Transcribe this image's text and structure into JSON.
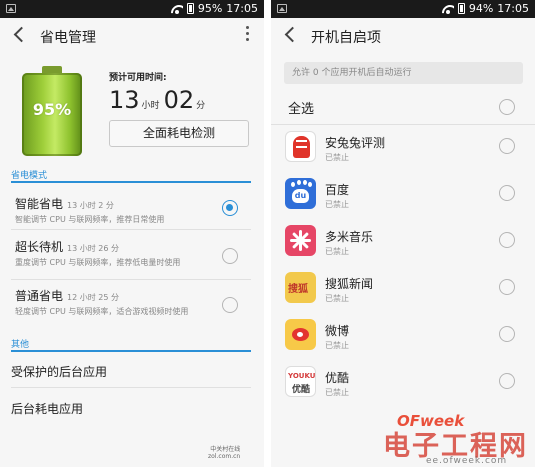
{
  "left": {
    "status": {
      "battery_pct": "95%",
      "time": "17:05"
    },
    "appbar": {
      "title": "省电管理"
    },
    "battery": {
      "percent_label": "95%",
      "level": 0.95
    },
    "estimate": {
      "label": "预计可用时间:",
      "hours": "13",
      "hours_unit": "小时",
      "minutes": "02",
      "minutes_unit": "分"
    },
    "check_button": "全面耗电检测",
    "modes_header": "省电模式",
    "modes": [
      {
        "name": "智能省电",
        "duration": "13 小时 2 分",
        "desc": "智能调节 CPU 与联网频率，推荐日常使用",
        "selected": true
      },
      {
        "name": "超长待机",
        "duration": "13 小时 26 分",
        "desc": "重度调节 CPU 与联网频率，推荐低电量时使用",
        "selected": false
      },
      {
        "name": "普通省电",
        "duration": "12 小时 25 分",
        "desc": "轻度调节 CPU 与联网频率，适合游戏视频时使用",
        "selected": false
      }
    ],
    "other_header": "其他",
    "other_items": [
      "受保护的后台应用",
      "后台耗电应用"
    ],
    "watermark": {
      "line1": "中关村在线",
      "line2": "zol.com.cn"
    }
  },
  "right": {
    "status": {
      "battery_pct": "94%",
      "time": "17:05"
    },
    "appbar": {
      "title": "开机自启项"
    },
    "allow_text": "允许 0 个应用开机后自动运行",
    "select_all": "全选",
    "apps": [
      {
        "name": "安兔兔评测",
        "status": "已禁止",
        "icon": "antutu-icon"
      },
      {
        "name": "百度",
        "status": "已禁止",
        "icon": "baidu-icon"
      },
      {
        "name": "多米音乐",
        "status": "已禁止",
        "icon": "duomi-icon"
      },
      {
        "name": "搜狐新闻",
        "status": "已禁止",
        "icon": "sohu-news-icon"
      },
      {
        "name": "微博",
        "status": "已禁止",
        "icon": "weibo-icon"
      },
      {
        "name": "优酷",
        "status": "已禁止",
        "icon": "youku-icon"
      }
    ],
    "icon_text": {
      "baidu": "du",
      "sohu": "搜狐",
      "youku_top": "YOUKU",
      "youku_bottom": "优酷"
    },
    "watermark": {
      "brand": "OFweek",
      "big": "电子工程网",
      "url": "ee.ofweek.com"
    }
  },
  "colors": {
    "accent": "#2a8fd6",
    "statusbar": "#1a1a1a",
    "battery_green": "#9fcf3a"
  }
}
